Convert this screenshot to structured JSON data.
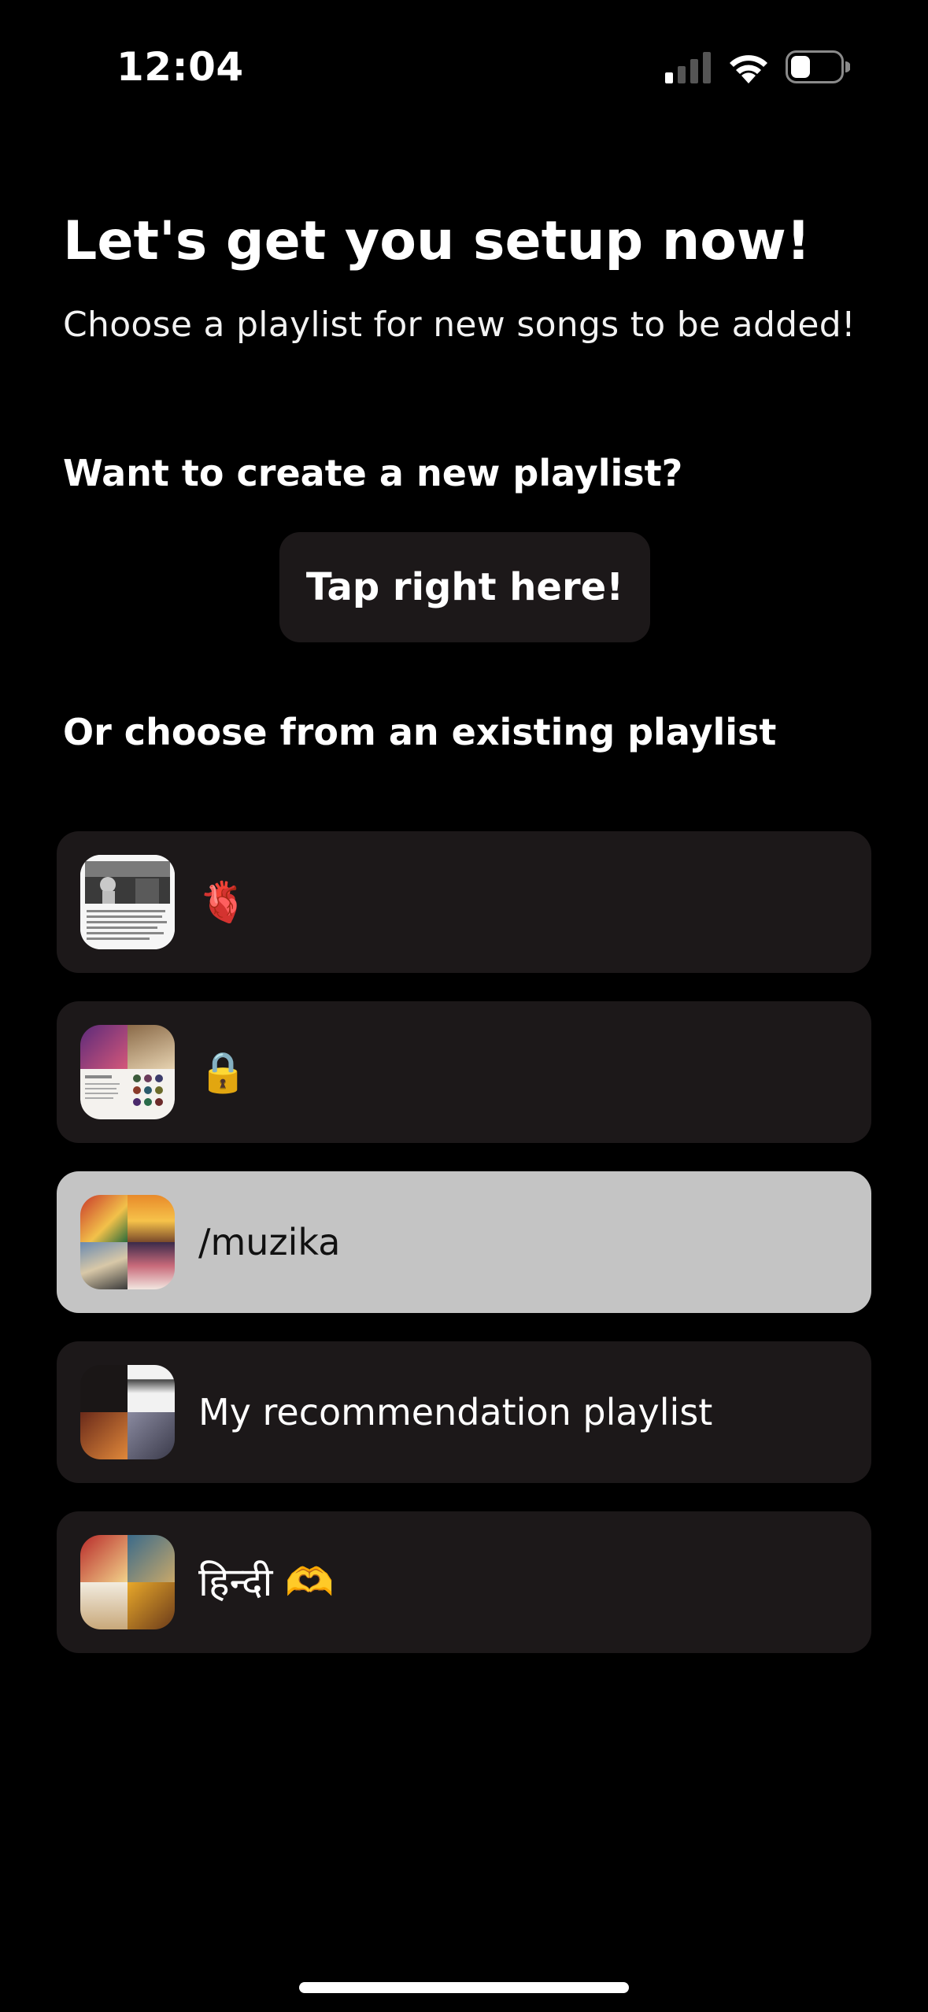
{
  "status_bar": {
    "time": "12:04",
    "icons": [
      "cellular-signal-icon",
      "wifi-icon",
      "battery-icon"
    ]
  },
  "header": {
    "title": "Let's get you setup now!",
    "subtitle": "Choose a playlist for new songs to be added!"
  },
  "create_section": {
    "heading": "Want to create a new playlist?",
    "button_label": "Tap right here!"
  },
  "existing_section": {
    "heading": "Or choose from an existing playlist"
  },
  "playlists": [
    {
      "name": "🫀",
      "cover": "playlist-cover-photo-text",
      "selected": false
    },
    {
      "name": "🔒",
      "cover": "playlist-cover-mosaic",
      "selected": false
    },
    {
      "name": "/muzika",
      "cover": "playlist-cover-mosaic",
      "selected": true
    },
    {
      "name": "My recommendation playlist",
      "cover": "playlist-cover-mosaic",
      "selected": false
    },
    {
      "name": "हिन्दी 🫶",
      "cover": "playlist-cover-mosaic",
      "selected": false
    }
  ],
  "colors": {
    "background": "#000000",
    "card": "#1c1819",
    "selected_card": "#c4c4c4",
    "text": "#ffffff"
  }
}
